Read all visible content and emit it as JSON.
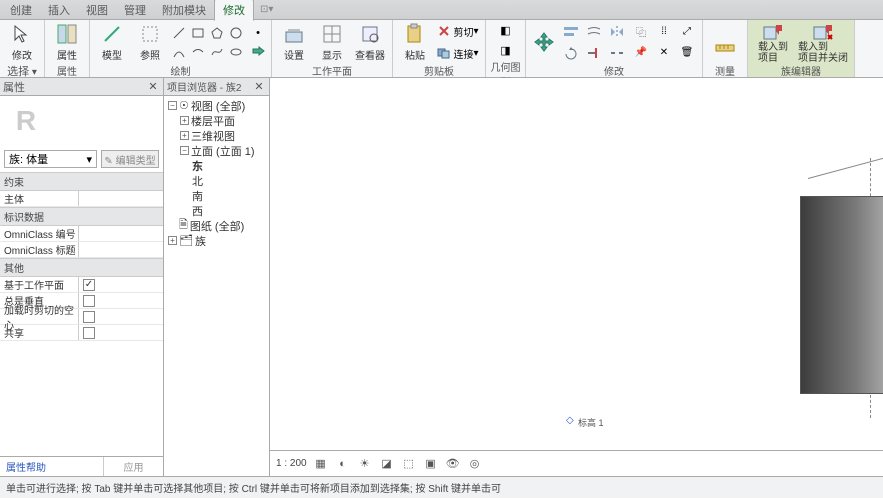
{
  "tabs": [
    "创建",
    "插入",
    "视图",
    "管理",
    "附加模块",
    "修改"
  ],
  "active_tab": 5,
  "extra_tab": "⊡▾",
  "ribbon": {
    "select": {
      "label": "选择",
      "btn": "修改"
    },
    "props": {
      "label": "属性",
      "btn": "属性"
    },
    "draw": {
      "label": "绘制"
    },
    "work": {
      "label": "工作平面",
      "btns": [
        "设置",
        "显示",
        "查看器"
      ]
    },
    "clip": {
      "label": "剪贴板",
      "btn": "粘贴",
      "side": [
        "剪切",
        "连接"
      ]
    },
    "geom": {
      "label": "几何图形"
    },
    "mod": {
      "label": "修改"
    },
    "measure": {
      "label": "测量"
    },
    "famedit": {
      "label": "族编辑器",
      "btns": [
        "载入到\n项目",
        "载入到\n项目并关闭"
      ]
    }
  },
  "props_panel": {
    "title": "属性",
    "type_label": "族: 体量",
    "edit_type": "✎ 编辑类型",
    "groups": [
      {
        "name": "约束",
        "rows": [
          {
            "k": "主体",
            "v": ""
          }
        ]
      },
      {
        "name": "标识数据",
        "rows": [
          {
            "k": "OmniClass 编号",
            "v": ""
          },
          {
            "k": "OmniClass 标题",
            "v": ""
          }
        ]
      },
      {
        "name": "其他",
        "rows": [
          {
            "k": "基于工作平面",
            "chk": true
          },
          {
            "k": "总是垂直",
            "chk": false
          },
          {
            "k": "加载时剪切的空心",
            "chk": false
          },
          {
            "k": "共享",
            "chk": false
          }
        ]
      }
    ],
    "help": "属性帮助",
    "apply": "应用"
  },
  "browser": {
    "title": "项目浏览器 - 族2",
    "tree": [
      {
        "t": "视图 (全部)",
        "exp": "−",
        "lvl": 0
      },
      {
        "t": "楼层平面",
        "exp": "+",
        "lvl": 1
      },
      {
        "t": "三维视图",
        "exp": "+",
        "lvl": 1
      },
      {
        "t": "立面 (立面 1)",
        "exp": "−",
        "lvl": 1
      },
      {
        "t": "东",
        "lvl": 2,
        "bold": true
      },
      {
        "t": "北",
        "lvl": 2
      },
      {
        "t": "南",
        "lvl": 2
      },
      {
        "t": "西",
        "lvl": 2
      },
      {
        "t": "图纸 (全部)",
        "exp": "",
        "lvl": 0,
        "icon": "sheet"
      },
      {
        "t": "族",
        "exp": "+",
        "lvl": 0,
        "icon": "fam"
      }
    ]
  },
  "canvas": {
    "anno": "标高 1",
    "scale": "1 : 200"
  },
  "status": "单击可进行选择; 按 Tab 键并单击可选择其他项目; 按 Ctrl 键并单击可将新项目添加到选择集; 按 Shift 键并单击可"
}
